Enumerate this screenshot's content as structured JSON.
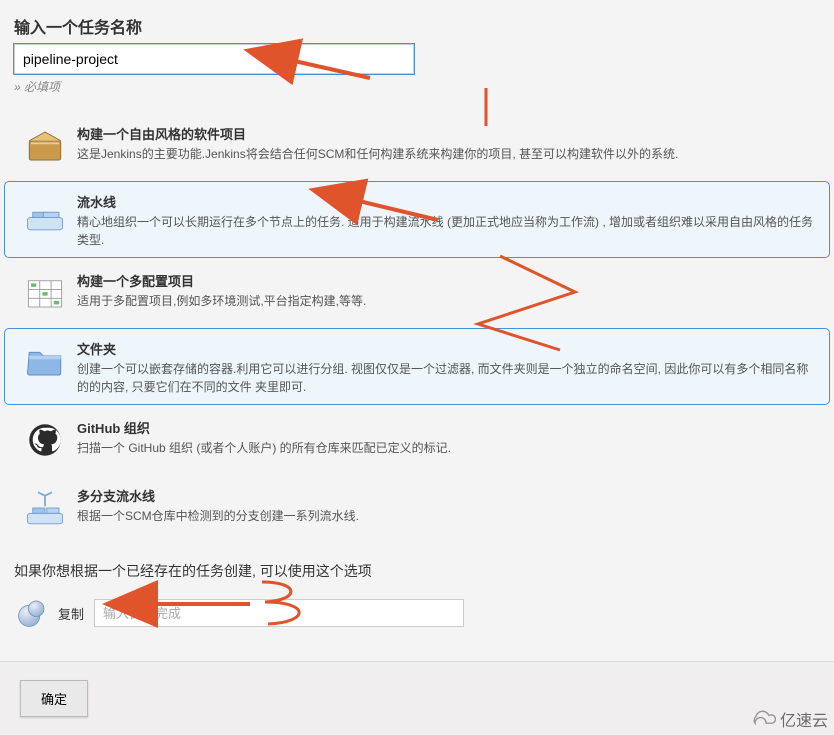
{
  "header": {
    "prompt": "输入一个任务名称",
    "name_value": "pipeline-project",
    "required_hint": "» 必填项"
  },
  "items": [
    {
      "title": "构建一个自由风格的软件项目",
      "desc": "这是Jenkins的主要功能.Jenkins将会结合任何SCM和任何构建系统来构建你的项目, 甚至可以构建软件以外的系统.",
      "selected": false,
      "icon": "freestyle"
    },
    {
      "title": "流水线",
      "desc": "精心地组织一个可以长期运行在多个节点上的任务. 适用于构建流水线 (更加正式地应当称为工作流) ,  增加或者组织难以采用自由风格的任务类型.",
      "selected": true,
      "icon": "pipeline"
    },
    {
      "title": "构建一个多配置项目",
      "desc": "适用于多配置项目,例如多环境测试,平台指定构建,等等.",
      "selected": false,
      "icon": "multi"
    },
    {
      "title": "文件夹",
      "desc": "创建一个可以嵌套存储的容器.利用它可以进行分组. 视图仅仅是一个过滤器,  而文件夹则是一个独立的命名空间,  因此你可以有多个相同名称的的内容, 只要它们在不同的文件 夹里即可.",
      "selected": true,
      "icon": "folder"
    },
    {
      "title": "GitHub 组织",
      "desc": "扫描一个 GitHub 组织 (或者个人账户) 的所有仓库来匹配已定义的标记.",
      "selected": false,
      "icon": "github"
    },
    {
      "title": "多分支流水线",
      "desc": "根据一个SCM仓库中检测到的分支创建一系列流水线.",
      "selected": false,
      "icon": "multibranch"
    }
  ],
  "copy": {
    "hint": "如果你想根据一个已经存在的任务创建,  可以使用这个选项",
    "label": "复制",
    "placeholder": "输入自动完成"
  },
  "footer": {
    "ok": "确定"
  },
  "watermark": {
    "text": "亿速云"
  }
}
